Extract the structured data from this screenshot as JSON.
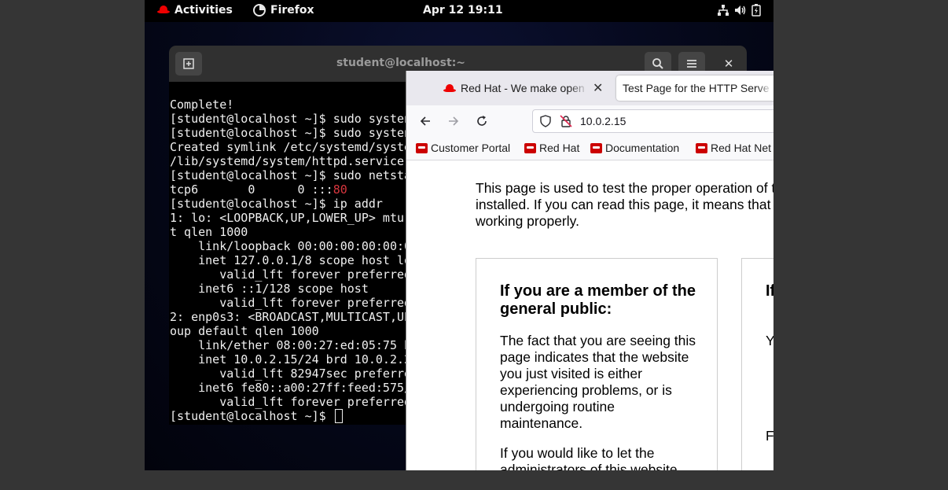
{
  "topbar": {
    "activities": "Activities",
    "app": "Firefox",
    "clock": "Apr 12  19:11"
  },
  "terminal": {
    "title": "student@localhost:~",
    "lines": [
      {
        "text": "Complete!"
      },
      {
        "text": "[student@localhost ~]$ sudo systen"
      },
      {
        "text": "[student@localhost ~]$ sudo systen"
      },
      {
        "text": "Created symlink /etc/systemd/syste"
      },
      {
        "text": "/lib/systemd/system/httpd.service"
      },
      {
        "text": "[student@localhost ~]$ sudo netsta"
      },
      {
        "text": "tcp6       0      0 :::",
        "highlight": "80"
      },
      {
        "text": "[student@localhost ~]$ ip addr"
      },
      {
        "text": "1: lo: <LOOPBACK,UP,LOWER_UP> mtu"
      },
      {
        "text": "t qlen 1000"
      },
      {
        "text": "    link/loopback 00:00:00:00:00:0"
      },
      {
        "text": "    inet 127.0.0.1/8 scope host lo"
      },
      {
        "text": "       valid_lft forever preferred"
      },
      {
        "text": "    inet6 ::1/128 scope host"
      },
      {
        "text": "       valid_lft forever preferred"
      },
      {
        "text": "2: enp0s3: <BROADCAST,MULTICAST,UP"
      },
      {
        "text": "oup default qlen 1000"
      },
      {
        "text": "    link/ether 08:00:27:ed:05:75 b"
      },
      {
        "text": "    inet 10.0.2.15/24 brd 10.0.2.2"
      },
      {
        "text": "       valid_lft 82947sec preferre"
      },
      {
        "text": "    inet6 fe80::a00:27ff:feed:575/"
      },
      {
        "text": "       valid_lft forever preferred"
      },
      {
        "text": "[student@localhost ~]$ "
      }
    ]
  },
  "browser": {
    "tabs": [
      {
        "label": "Red Hat - We make open s"
      },
      {
        "label": "Test Page for the HTTP Serve"
      }
    ],
    "url": "10.0.2.15",
    "bookmarks": [
      {
        "label": "Customer Portal"
      },
      {
        "label": "Red Hat"
      },
      {
        "label": "Documentation"
      },
      {
        "label": "Red Hat Net"
      }
    ],
    "page": {
      "intro": "This page is used to test the proper operation of t installed. If you can read this page, it means that is working properly.",
      "card1": {
        "heading": "If you are a member of the general public:",
        "p1": "The fact that you are seeing this page indicates that the website you just visited is either experiencing problems, or is undergoing routine maintenance.",
        "p2": "If you would like to let the administrators of this website"
      },
      "card2": {
        "heading": "If a",
        "p1": "Y th u y a",
        "p2": "F H a"
      }
    }
  }
}
